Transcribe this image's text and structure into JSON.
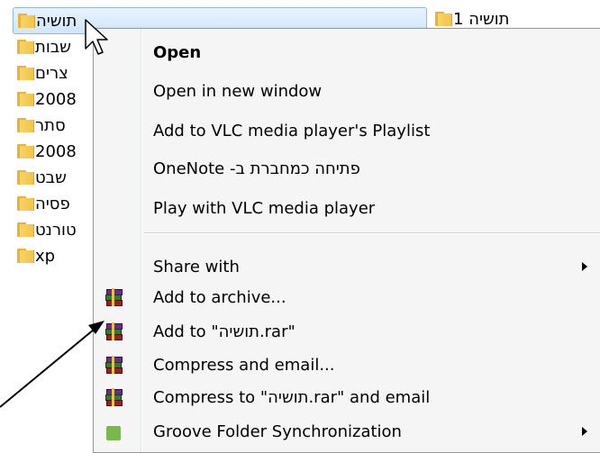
{
  "files": [
    {
      "name": "תושיה",
      "selected": true
    },
    {
      "name": "שבות"
    },
    {
      "name": "צרים"
    },
    {
      "name": "2008"
    },
    {
      "name": "סתר"
    },
    {
      "name": "2008"
    },
    {
      "name": "שבט"
    },
    {
      "name": "פסיה"
    },
    {
      "name": "טורנט"
    },
    {
      "name": "xp"
    }
  ],
  "right_folder_label": "1 תושיה",
  "menu": {
    "open": "Open",
    "open_new_window": "Open in new window",
    "add_vlc_playlist": "Add to VLC media player's Playlist",
    "onenote": "פתיחה כמחברת ב- OneNote",
    "play_vlc": "Play with VLC media player",
    "share_with": "Share with",
    "add_archive": "Add to archive...",
    "add_to_rar": "Add to \"תושיה.rar\"",
    "compress_email": "Compress and email...",
    "compress_rar_email": "Compress to \"תושיה.rar\" and email",
    "groove": "Groove Folder Synchronization"
  },
  "colors": {
    "selection": "#cfe6fb",
    "menu_bg": "#f5f5f5",
    "folder": "#f3c445"
  }
}
